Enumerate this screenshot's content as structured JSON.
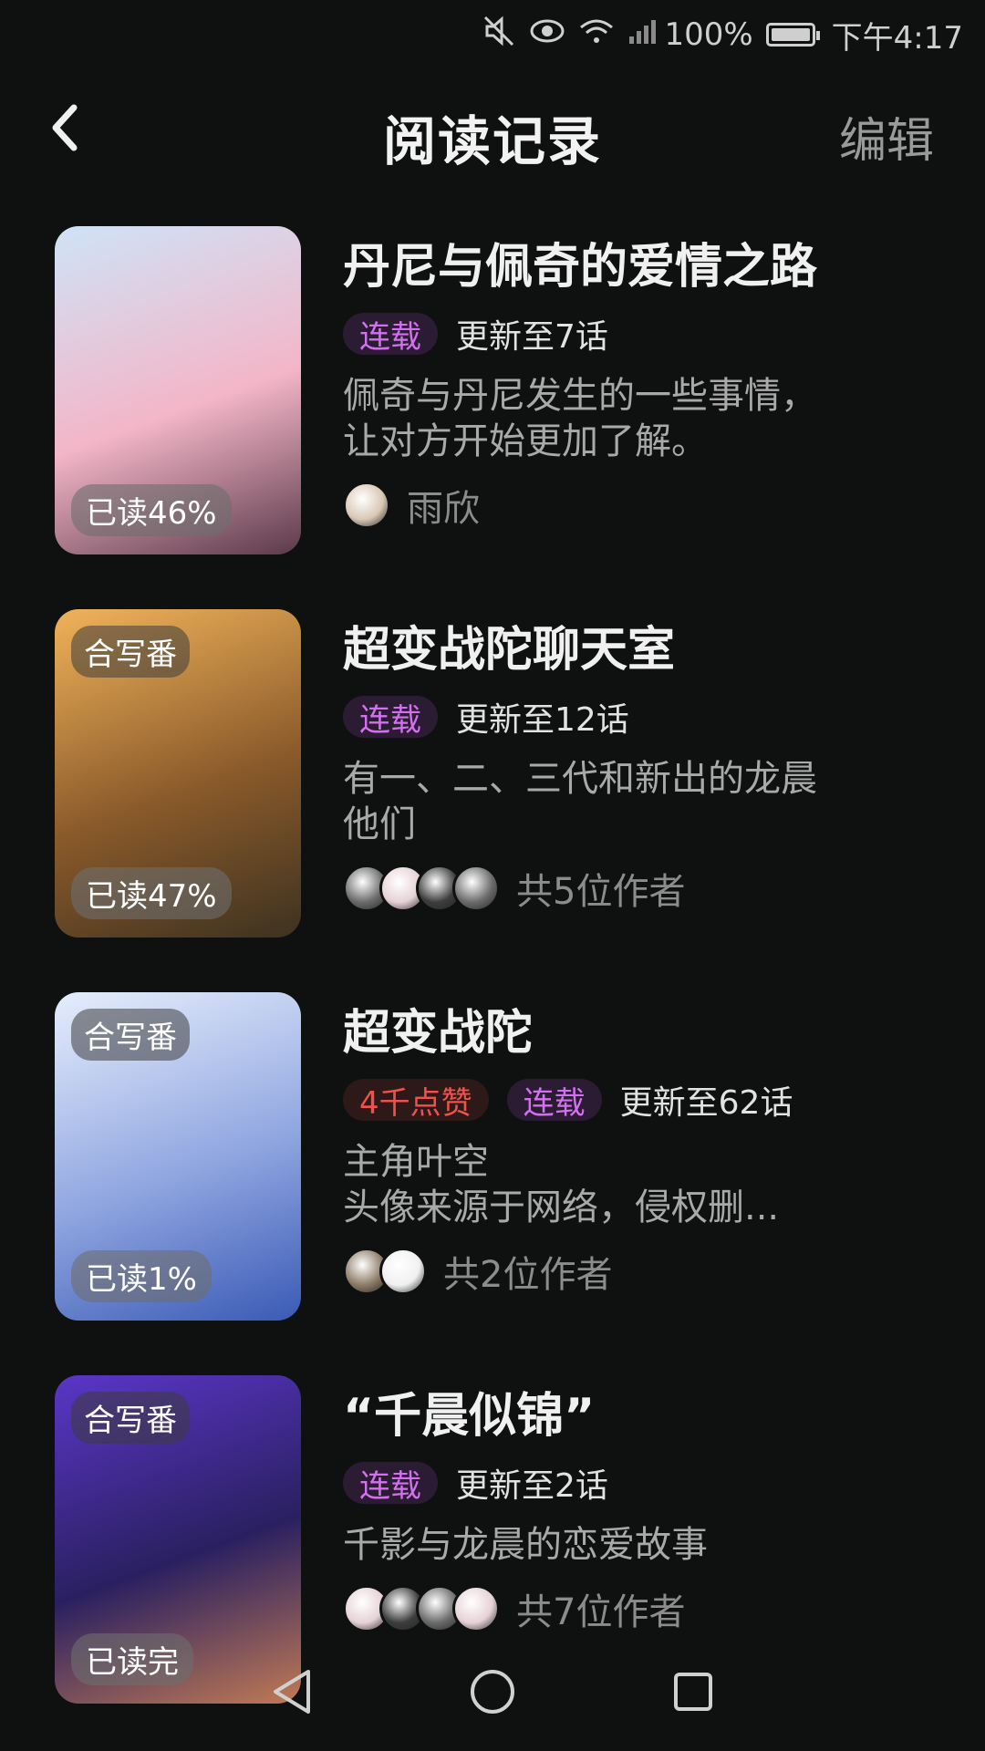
{
  "status_bar": {
    "battery_percent": "100%",
    "time": "下午4:17",
    "icons": [
      "mute-icon",
      "eye-icon",
      "wifi-icon",
      "signal-icon",
      "battery-icon"
    ]
  },
  "header": {
    "title": "阅读记录",
    "edit_label": "编辑"
  },
  "items": [
    {
      "title": "丹尼与佩奇的爱情之路",
      "cover_tag": "",
      "read_progress": "已读46%",
      "likes": "",
      "status": "连载",
      "update": "更新至7话",
      "description": [
        "佩奇与丹尼发生的一些事情，",
        "让对方开始更加了解。"
      ],
      "authors_text": "雨欣",
      "avatar_count": 1,
      "cover_colors": [
        "#cfe3f7",
        "#f3b6c8",
        "#5b3a4a"
      ]
    },
    {
      "title": "超变战陀聊天室",
      "cover_tag": "合写番",
      "read_progress": "已读47%",
      "likes": "",
      "status": "连载",
      "update": "更新至12话",
      "description": [
        "有一、二、三代和新出的龙晨",
        "他们"
      ],
      "authors_text": "共5位作者",
      "avatar_count": 4,
      "cover_colors": [
        "#f1b35a",
        "#8a5a2a",
        "#3d3220"
      ]
    },
    {
      "title": "超变战陀",
      "cover_tag": "合写番",
      "read_progress": "已读1%",
      "likes": "4千点赞",
      "status": "连载",
      "update": "更新至62话",
      "description": [
        "主角叶空",
        "头像来源于网络，侵权删..."
      ],
      "authors_text": "共2位作者",
      "avatar_count": 2,
      "cover_colors": [
        "#e6eefc",
        "#8fa5e0",
        "#3a5ab5"
      ]
    },
    {
      "title": "“千晨似锦”",
      "cover_tag": "合写番",
      "read_progress": "已读完",
      "likes": "",
      "status": "连载",
      "update": "更新至2话",
      "description": [
        "千影与龙晨的恋爱故事"
      ],
      "authors_text": "共7位作者",
      "avatar_count": 4,
      "cover_colors": [
        "#5a36c8",
        "#2a2060",
        "#c07a55"
      ]
    }
  ],
  "navbar": {
    "icons": [
      "back-triangle-icon",
      "home-circle-icon",
      "recents-square-icon"
    ]
  }
}
